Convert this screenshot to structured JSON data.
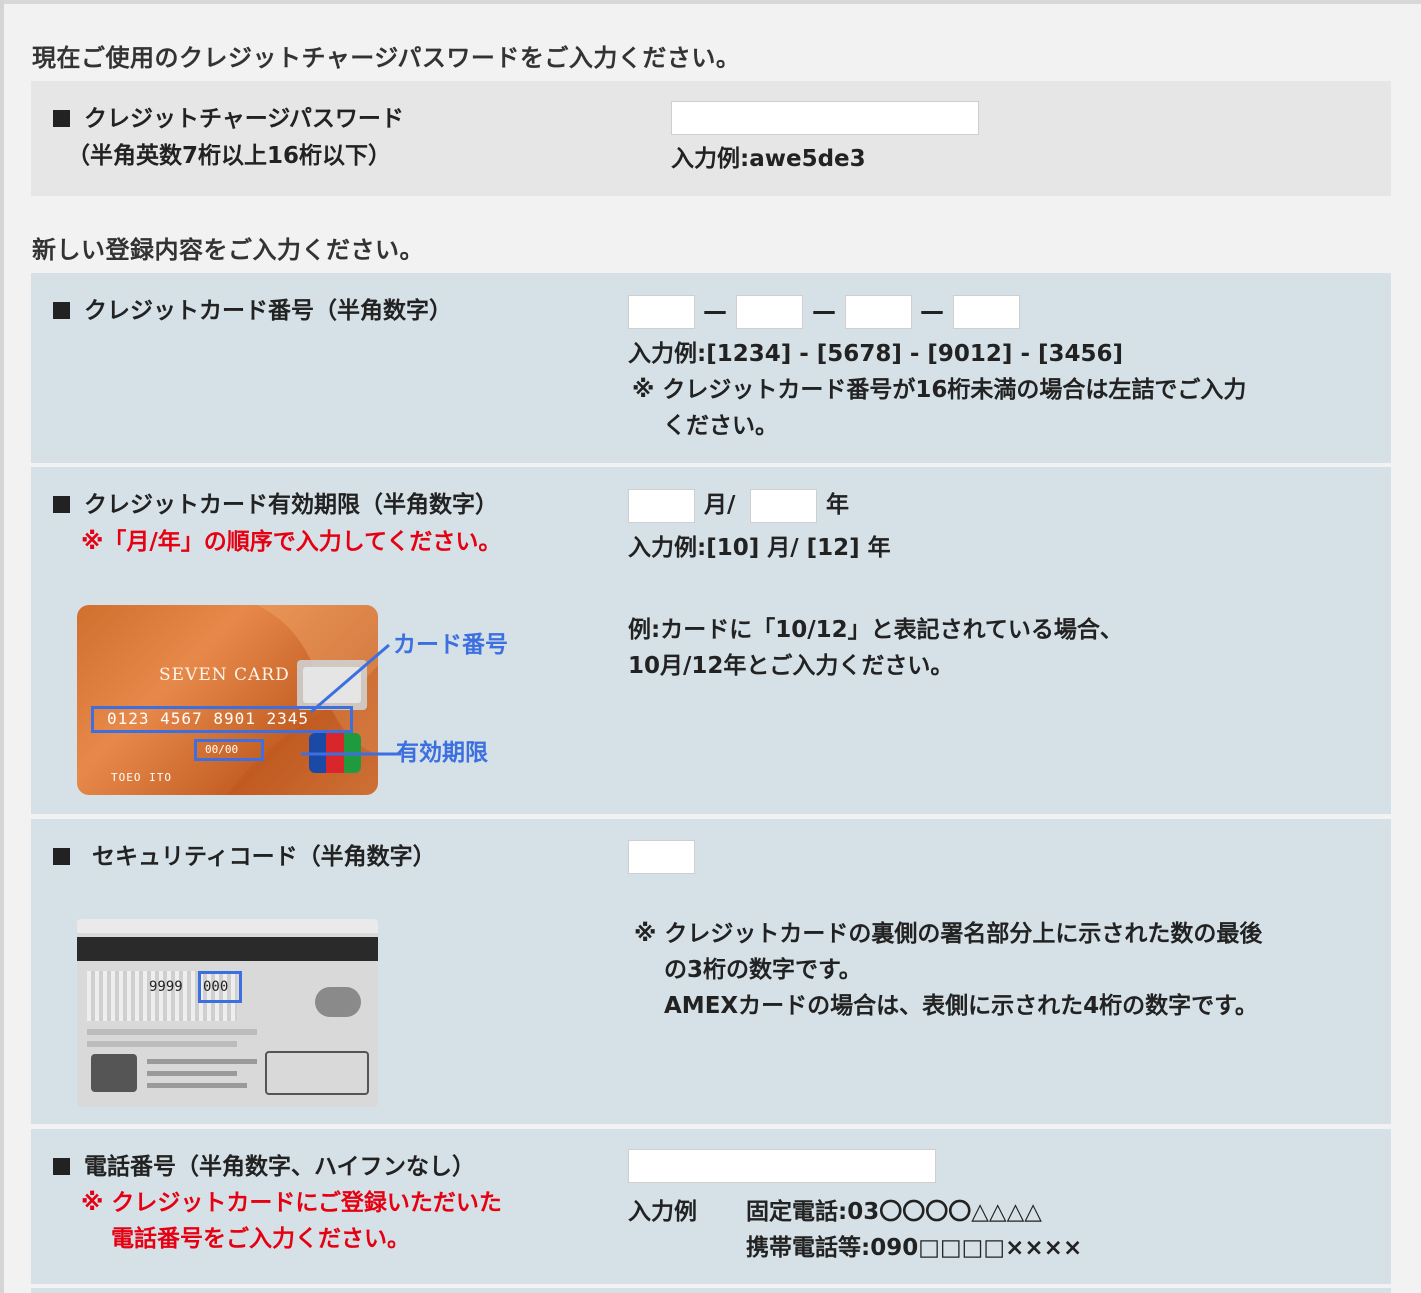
{
  "headings": {
    "current": "現在ご使用のクレジットチャージパスワードをご入力ください。",
    "new": "新しい登録内容をご入力ください。"
  },
  "password": {
    "label": "クレジットチャージパスワード",
    "sublabel": "（半角英数7桁以上16桁以下）",
    "example": "入力例:awe5de3",
    "value": ""
  },
  "card_number": {
    "label": "クレジットカード番号（半角数字）",
    "separator": "—",
    "example": "入力例:[1234] - [5678] - [9012] - [3456]",
    "note_line1": "※ クレジットカード番号が16桁未満の場合は左詰でご入力",
    "note_line2": "ください。",
    "values": [
      "",
      "",
      "",
      ""
    ]
  },
  "expiry": {
    "label": "クレジットカード有効期限（半角数字）",
    "note": "※「月/年」の順序で入力してください。",
    "month_suffix": "月/",
    "year_suffix": "年",
    "example": "入力例:[10] 月/ [12] 年",
    "desc_line1": "例:カードに「10/12」と表記されている場合、",
    "desc_line2": "10月/12年とご入力ください。",
    "card_image": {
      "brand": "SEVEN CARD",
      "number": "0123 4567 8901 2345",
      "expiry_text": "00/00",
      "holder": "TOEO ITO",
      "callout_number": "カード番号",
      "callout_expiry": "有効期限",
      "logo": "JCB"
    }
  },
  "security": {
    "label": "セキュリティコード（半角数字）",
    "note_line1": "※ クレジットカードの裏側の署名部分上に示された数の最後",
    "note_line2": "の3桁の数字です。",
    "note_line3": "AMEXカードの場合は、表側に示された4桁の数字です。",
    "card_back": {
      "sig_digits": "9999",
      "code_digits": "000"
    }
  },
  "phone": {
    "label": "電話番号（半角数字、ハイフンなし）",
    "note_line1": "※ クレジットカードにご登録いただいた",
    "note_line2": "電話番号をご入力ください。",
    "example_label": "入力例",
    "example_fixed": "固定電話:03〇〇〇〇△△△△",
    "example_mobile": "携帯電話等:090□□□□××××"
  },
  "colors": {
    "gray_row": "#e6e6e6",
    "blue_row": "#d5e1e6",
    "red_note": "#e60012",
    "callout_blue": "#3c6fe0"
  }
}
